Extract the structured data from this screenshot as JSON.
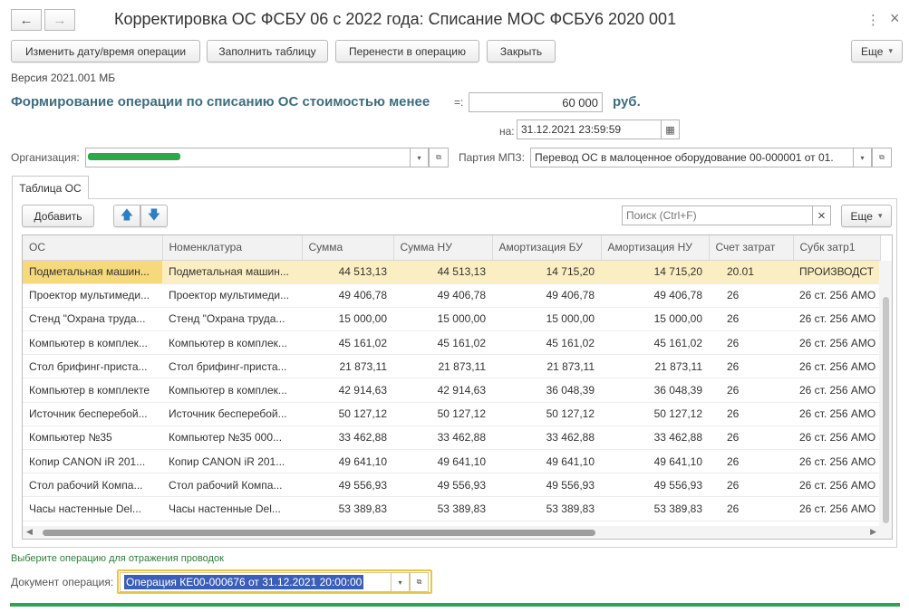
{
  "window": {
    "title": "Корректировка ОС ФСБУ 06 с 2022 года: Списание МОС ФСБУ6 2020 001",
    "back": "←",
    "forward": "→",
    "menu": "⋮",
    "close": "×"
  },
  "toolbar": {
    "change_date": "Изменить дату/время операции",
    "fill_table": "Заполнить таблицу",
    "transfer": "Перенести в операцию",
    "close": "Закрыть",
    "more": "Еще",
    "more_arrow": "▾"
  },
  "version": "Версия 2021.001 МБ",
  "heading": {
    "text": "Формирование операции по списанию ОС стоимостью менее",
    "eq": "=:",
    "amount": "60 000",
    "currency": "руб."
  },
  "date": {
    "label": "на:",
    "value": "31.12.2021 23:59:59"
  },
  "organization": {
    "label": "Организация:",
    "value": ""
  },
  "party": {
    "label": "Партия МПЗ:",
    "value": "Перевод ОС в малоценное оборудование      00-000001 от 01."
  },
  "tab": {
    "label": "Таблица ОС"
  },
  "table_toolbar": {
    "add": "Добавить",
    "up": "🡅",
    "down": "🡇",
    "search_placeholder": "Поиск (Ctrl+F)",
    "clear": "×",
    "more": "Еще"
  },
  "table": {
    "columns": [
      "ОС",
      "Номенклатура",
      "Сумма",
      "Сумма НУ",
      "Амортизация БУ",
      "Амортизация НУ",
      "Счет затрат",
      "Субк затр1"
    ],
    "rows": [
      [
        "Подметальная машин...",
        "Подметальная машин...",
        "44 513,13",
        "44 513,13",
        "14 715,20",
        "14 715,20",
        "20.01",
        "ПРОИЗВОДСТ"
      ],
      [
        "Проектор мультимеди...",
        "Проектор мультимеди...",
        "49 406,78",
        "49 406,78",
        "49 406,78",
        "49 406,78",
        "26",
        "26 ст. 256 АМО"
      ],
      [
        "Стенд \"Охрана труда...",
        "Стенд \"Охрана труда...",
        "15 000,00",
        "15 000,00",
        "15 000,00",
        "15 000,00",
        "26",
        "26 ст. 256 АМО"
      ],
      [
        "Компьютер в комплек...",
        "Компьютер в комплек...",
        "45 161,02",
        "45 161,02",
        "45 161,02",
        "45 161,02",
        "26",
        "26 ст. 256 АМО"
      ],
      [
        "Стол брифинг-приста...",
        "Стол брифинг-приста...",
        "21 873,11",
        "21 873,11",
        "21 873,11",
        "21 873,11",
        "26",
        "26 ст. 256 АМО"
      ],
      [
        "Компьютер в комплекте",
        "Компьютер в комплек...",
        "42 914,63",
        "42 914,63",
        "36 048,39",
        "36 048,39",
        "26",
        "26 ст. 256 АМО"
      ],
      [
        "Источник бесперебой...",
        "Источник бесперебой...",
        "50 127,12",
        "50 127,12",
        "50 127,12",
        "50 127,12",
        "26",
        "26 ст. 256 АМО"
      ],
      [
        "Компьютер №35",
        "Компьютер №35 000...",
        "33 462,88",
        "33 462,88",
        "33 462,88",
        "33 462,88",
        "26",
        "26 ст. 256 АМО"
      ],
      [
        "Копир CANON iR 201...",
        "Копир CANON iR 201...",
        "49 641,10",
        "49 641,10",
        "49 641,10",
        "49 641,10",
        "26",
        "26 ст. 256 АМО"
      ],
      [
        "Стол рабочий  Компа...",
        "Стол рабочий  Компа...",
        "49 556,93",
        "49 556,93",
        "49 556,93",
        "49 556,93",
        "26",
        "26 ст. 256 АМО"
      ],
      [
        "Часы настенные Del...",
        "Часы настенные Del...",
        "53 389,83",
        "53 389,83",
        "53 389,83",
        "53 389,83",
        "26",
        "26 ст. 256 АМО"
      ]
    ],
    "selected_row": 0
  },
  "hint": "Выберите операцию для отражения проводок",
  "document": {
    "label": "Документ операция:",
    "value": "Операция КЕ00-000676 от 31.12.2021 20:00:00"
  },
  "colors": {
    "heading": "#3f6d7d",
    "hint": "#2f7d3c",
    "selection_row": "#fbeec3",
    "selection_cell": "#f5d97a",
    "accent_green": "#2ea44f",
    "doc_highlight": "#3b5fb8"
  },
  "icons": {
    "dropdown": "▾",
    "open": "⧉",
    "calendar": "▦"
  }
}
